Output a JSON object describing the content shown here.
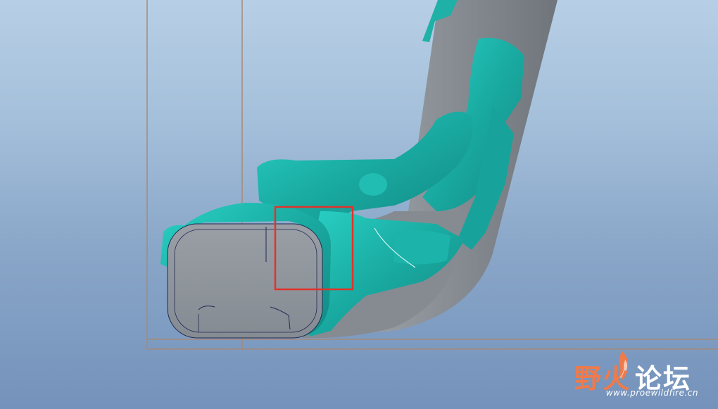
{
  "viewport": {
    "background_top": "#b7cfe6",
    "background_bottom": "#7492bb",
    "model_gray": "#8d9399",
    "model_teal": "#1fb0a7",
    "datum_color": "#a58a78",
    "highlight_box_color": "#e0332a"
  },
  "watermark": {
    "title_part1": "野火",
    "title_part2": "论坛",
    "url": "www.proewildfire.cn",
    "accent": "#f07a4a",
    "icon": "flame-icon"
  }
}
